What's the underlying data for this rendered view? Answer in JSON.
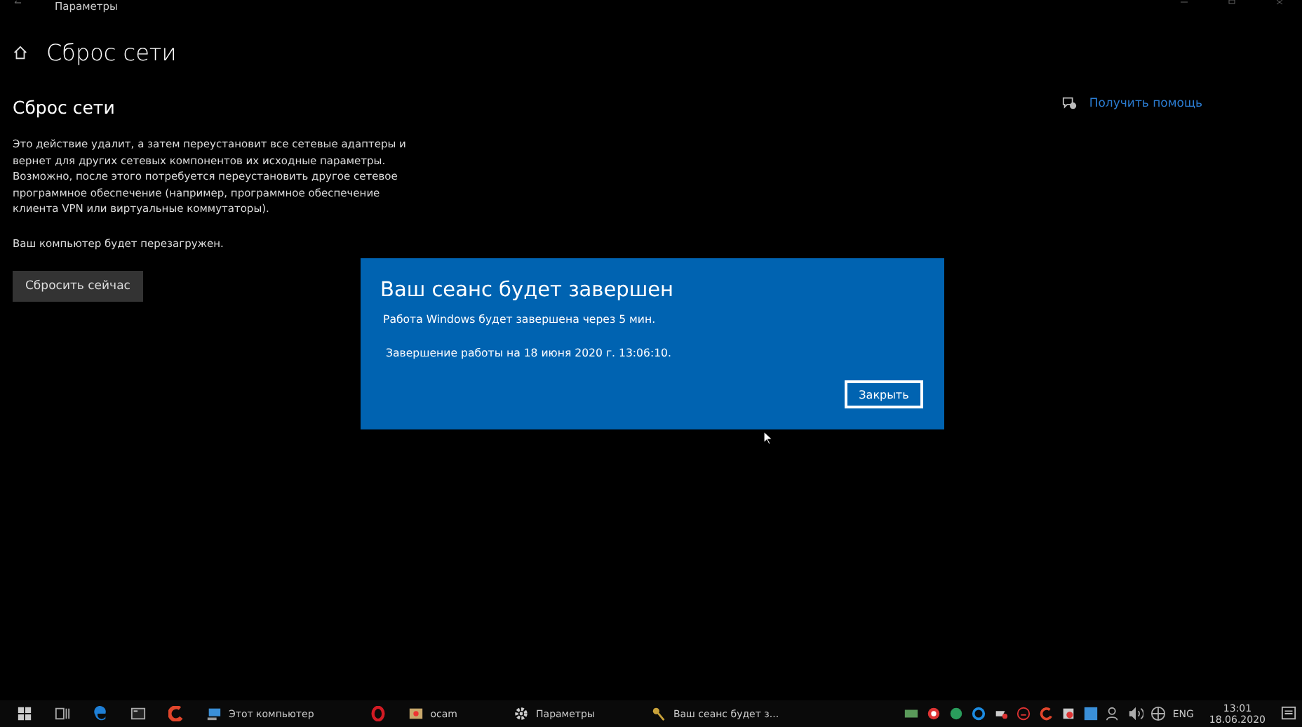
{
  "window": {
    "title": "Параметры"
  },
  "page": {
    "title": "Сброс сети",
    "section": "Сброс сети",
    "description": "Это действие удалит, а затем переустановит все сетевые адаптеры и вернет для других сетевых компонентов их исходные параметры. Возможно, после этого потребуется переустановить другое сетевое программное обеспечение (например, программное обеспечение клиента VPN или виртуальные коммутаторы).",
    "note": "Ваш компьютер будет перезагружен.",
    "button": "Сбросить сейчас",
    "help_link": "Получить помощь"
  },
  "dialog": {
    "title": "Ваш сеанс будет завершен",
    "message": "Работа Windows будет завершена через 5 мин.",
    "detail": "Завершение работы на 18 июня 2020 г. 13:06:10.",
    "button": "Закрыть"
  },
  "taskbar": {
    "apps": [
      {
        "kind": "edge"
      },
      {
        "kind": "terminal"
      },
      {
        "kind": "ccleaner"
      },
      {
        "kind": "computer",
        "label": "Этот компьютер"
      },
      {
        "kind": "opera"
      },
      {
        "kind": "ocam",
        "label": "ocam"
      },
      {
        "kind": "settings",
        "label": "Параметры"
      },
      {
        "kind": "keys",
        "label": "Ваш сеанс будет з..."
      }
    ],
    "language": "ENG",
    "time": "13:01",
    "date": "18.06.2020"
  }
}
